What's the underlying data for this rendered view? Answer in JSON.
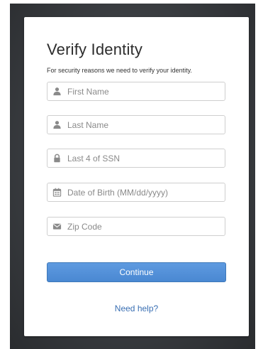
{
  "form": {
    "title": "Verify Identity",
    "subtitle": "For security reasons we need to verify your identity.",
    "fields": [
      {
        "icon": "user-icon",
        "placeholder": "First Name",
        "value": ""
      },
      {
        "icon": "user-icon",
        "placeholder": "Last Name",
        "value": ""
      },
      {
        "icon": "lock-icon",
        "placeholder": "Last 4 of SSN",
        "value": ""
      },
      {
        "icon": "calendar-icon",
        "placeholder": "Date of Birth (MM/dd/yyyy)",
        "value": ""
      },
      {
        "icon": "envelope-icon",
        "placeholder": "Zip Code",
        "value": ""
      }
    ],
    "continue_label": "Continue",
    "help_label": "Need help?"
  },
  "colors": {
    "accent": "#4a88d2",
    "link": "#3a6fb3",
    "backdrop": "#3a3d41",
    "icon": "#8a8a8a"
  }
}
